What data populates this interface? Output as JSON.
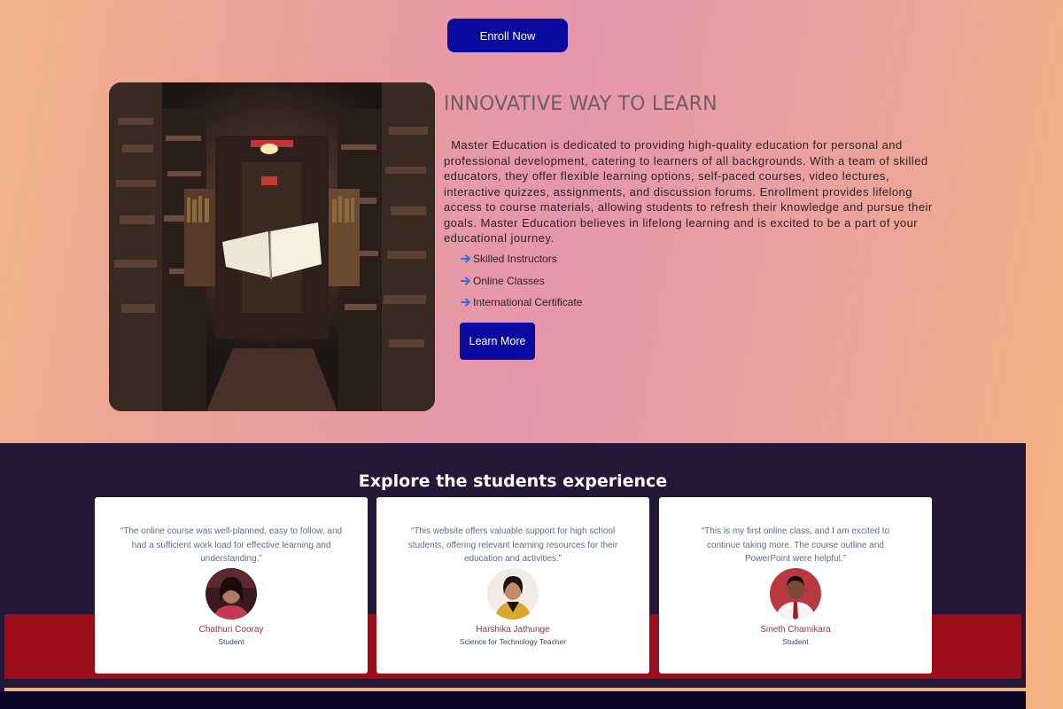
{
  "header": {
    "enroll_label": "Enroll Now"
  },
  "about": {
    "title": "INNOVATIVE WAY TO LEARN",
    "description": "  Master Education is dedicated to providing high-quality education for personal and professional development, catering to learners of all backgrounds. With a team of skilled educators, they offer flexible learning options, self-paced courses, video lectures, interactive quizzes, assignments, and discussion forums. Enrollment provides lifelong access to course materials, allowing students to refresh their knowledge and pursue their goals. Master Education believes in lifelong learning and is excited to be a part of your educational journey.",
    "features": [
      "Skilled Instructors",
      "Online Classes",
      "International Certificate"
    ],
    "learn_more_label": "Learn More",
    "feature_icon": "arrow-right-icon"
  },
  "testimonials": {
    "title": "Explore the students experience",
    "cards": [
      {
        "quote": "“The online course was well-planned, easy to follow, and had a sufficient work load for effective learning and understanding.”",
        "name": "Chathuri Cooray",
        "role": "Student"
      },
      {
        "quote": "“This website offers valuable support for high school students, offering relevant learning resources for their education and activities.”",
        "name": "Harshika Jathunge",
        "role": "Science for Technology Teacher"
      },
      {
        "quote": "“This is my first online class, and I am excited to continue taking more. The course outline and PowerPoint were helpful.”",
        "name": "Sineth Chamikara",
        "role": "Student"
      }
    ]
  },
  "colors": {
    "button_blue": "#0a0aa0",
    "testimonial_bg": "#241737",
    "red_band": "#9b0d18",
    "gold_line": "#f1b680",
    "arrow_blue": "#2a72e8"
  }
}
